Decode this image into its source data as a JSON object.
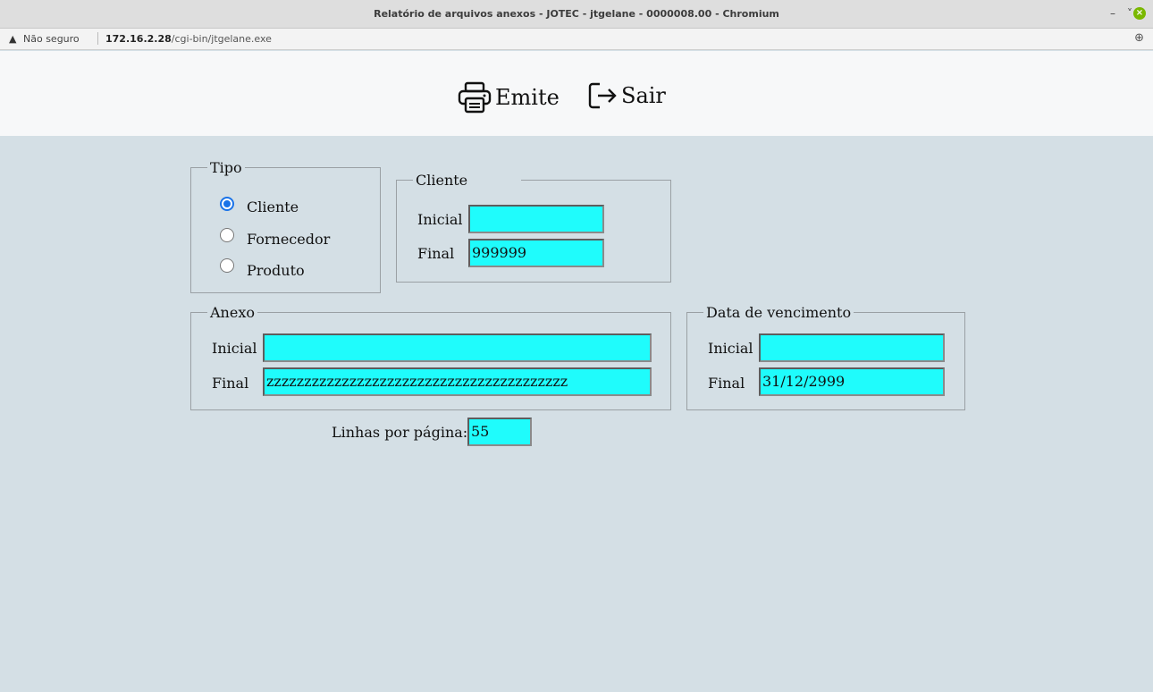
{
  "window": {
    "title": "Relatório de arquivos anexos - JOTEC - jtgelane - 0000008.00 - Chromium",
    "minimize": "–",
    "restore": "˅",
    "close": "×"
  },
  "address": {
    "warning_icon": "▲",
    "insecure": "Não seguro",
    "host": "172.16.2.28",
    "path": "/cgi-bin/jtgelane.exe",
    "zoom_icon": "⊕"
  },
  "toolbar": {
    "emite_label": "Emite",
    "sair_label": "Sair",
    "icons": [
      "printer-icon",
      "exit-icon"
    ]
  },
  "tipo": {
    "legend": "Tipo",
    "options": [
      {
        "label": "Cliente",
        "checked": true
      },
      {
        "label": "Fornecedor",
        "checked": false
      },
      {
        "label": "Produto",
        "checked": false
      }
    ]
  },
  "cliente": {
    "legend": "Cliente",
    "inicial_label": "Inicial",
    "inicial_value": "",
    "final_label": "Final",
    "final_value": "999999"
  },
  "anexo": {
    "legend": "Anexo",
    "inicial_label": "Inicial",
    "inicial_value": "",
    "final_label": "Final",
    "final_value": "zzzzzzzzzzzzzzzzzzzzzzzzzzzzzzzzzzzzzzzz"
  },
  "vencimento": {
    "legend": "Data de vencimento",
    "inicial_label": "Inicial",
    "inicial_value": "",
    "final_label": "Final",
    "final_value": "31/12/2999"
  },
  "linhas": {
    "label": "Linhas por página:",
    "value": "55"
  },
  "colors": {
    "background": "#d4dfe5",
    "input": "#1ffcfc",
    "radio_selected": "#1a73e8"
  }
}
